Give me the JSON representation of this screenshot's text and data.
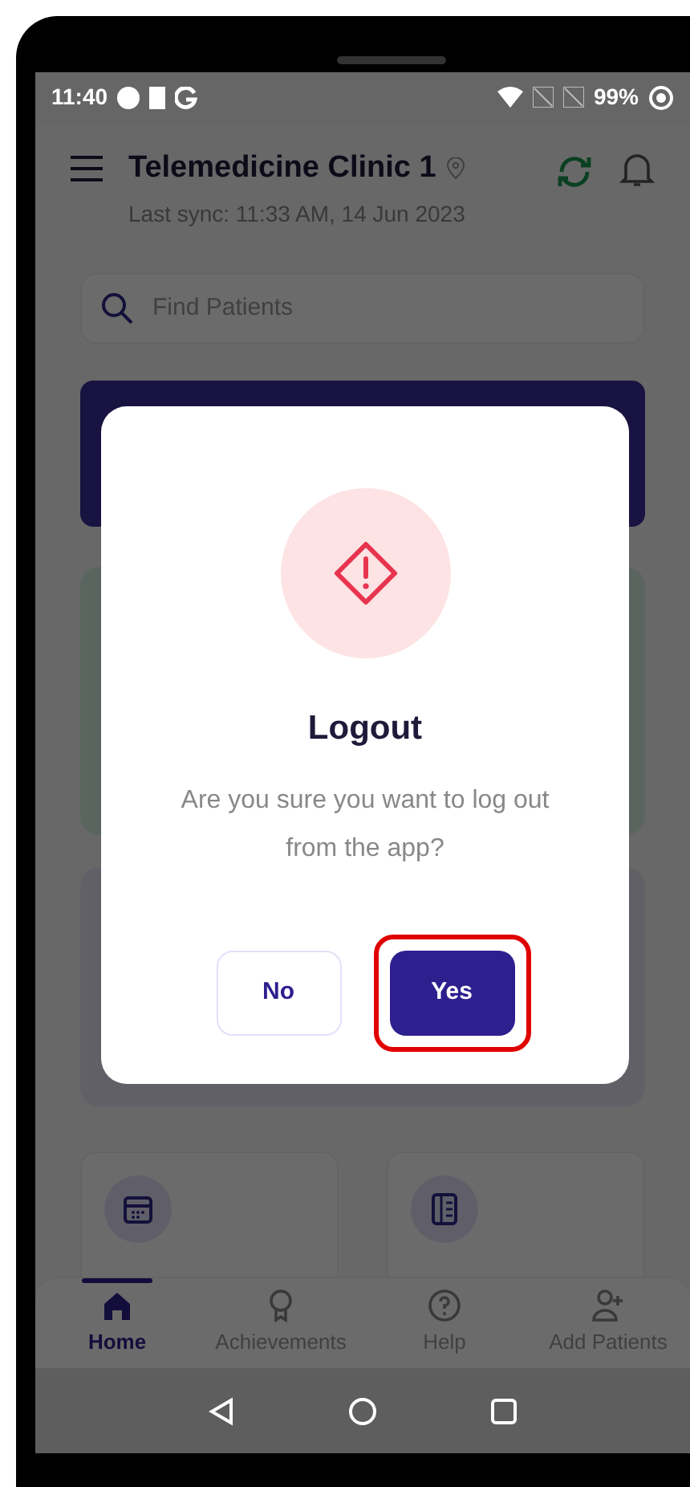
{
  "status_bar": {
    "time": "11:40",
    "battery": "99%"
  },
  "header": {
    "title": "Telemedicine Clinic 1",
    "subtitle": "Last sync: 11:33 AM, 14 Jun 2023"
  },
  "search": {
    "placeholder": "Find Patients"
  },
  "dialog": {
    "title": "Logout",
    "message": "Are you sure you want to log out from the app?",
    "buttons": [
      {
        "label": "No",
        "kind": "secondary",
        "highlighted": false
      },
      {
        "label": "Yes",
        "kind": "primary",
        "highlighted": true
      }
    ]
  },
  "bottom_nav": [
    {
      "label": "Home",
      "kind": "home",
      "selected": true
    },
    {
      "label": "Achievements",
      "kind": "award",
      "selected": false
    },
    {
      "label": "Help",
      "kind": "help",
      "selected": false
    },
    {
      "label": "Add Patients",
      "kind": "add-user",
      "selected": false
    }
  ]
}
